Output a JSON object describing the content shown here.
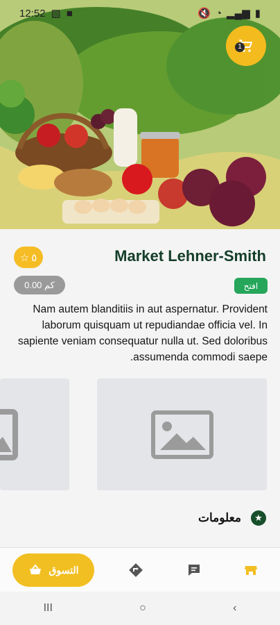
{
  "status": {
    "time": "12:52"
  },
  "cart": {
    "count": "1"
  },
  "store": {
    "title": "Market Lehner-Smith",
    "rating": "٥",
    "distance": "0.00 كم",
    "status": "افتح",
    "description": "Nam autem blanditiis in aut aspernatur. Provident laborum quisquam ut repudiandae officia vel. In sapiente veniam consequatur nulla ut. Sed doloribus assumenda commodi saepe."
  },
  "info": {
    "title": "معلومات"
  },
  "bottom_nav": {
    "shop_label": "التسوق"
  },
  "colors": {
    "accent": "#f4bb1f",
    "open": "#25a65a",
    "title": "#143d2a",
    "info_icon": "#174f2b"
  }
}
